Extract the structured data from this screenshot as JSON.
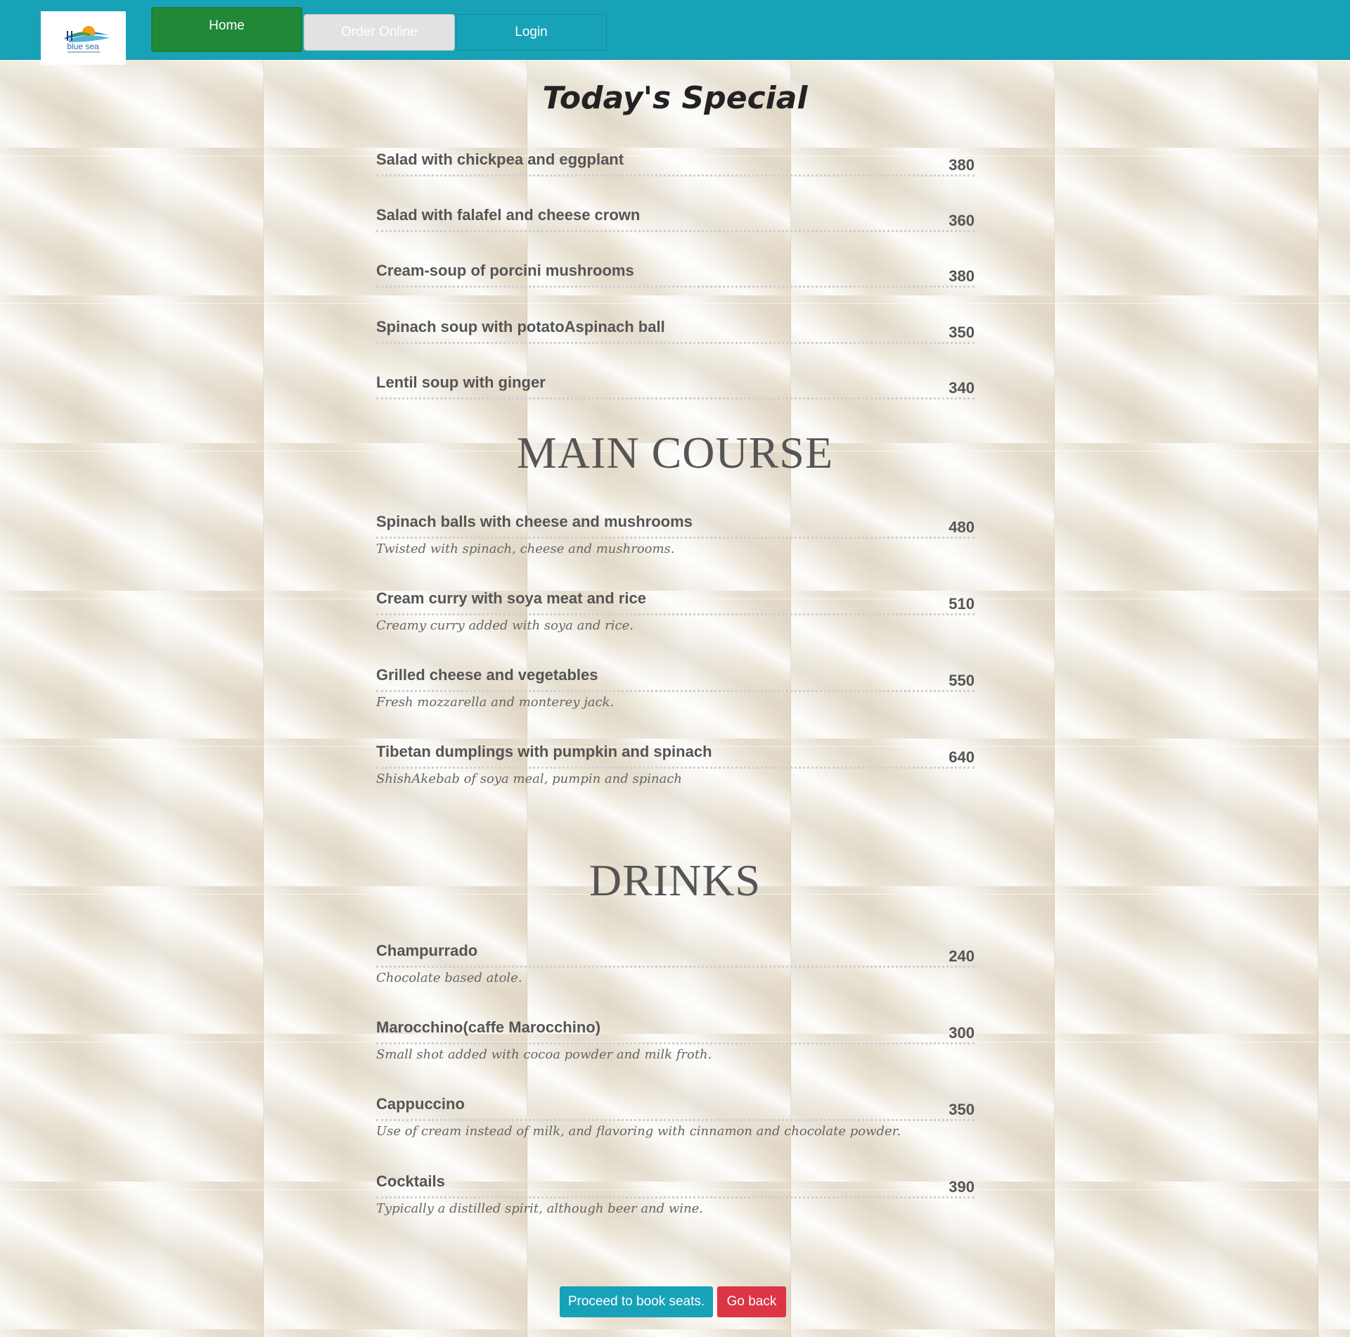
{
  "nav": {
    "logo_text": "blue sea",
    "home": "Home",
    "order_online": "Order Online",
    "login": "Login"
  },
  "sections": {
    "specials": {
      "title": "Today's Special",
      "items": [
        {
          "name": "Salad with chickpea and eggplant",
          "price": "380"
        },
        {
          "name": "Salad with falafel and cheese crown",
          "price": "360"
        },
        {
          "name": "Cream-soup of porcini mushrooms",
          "price": "380"
        },
        {
          "name": "Spinach soup with potatoAspinach ball",
          "price": "350"
        },
        {
          "name": "Lentil soup with ginger",
          "price": "340"
        }
      ]
    },
    "main_course": {
      "title": "MAIN COURSE",
      "items": [
        {
          "name": "Spinach balls with cheese and mushrooms",
          "price": "480",
          "desc": "Twisted with spinach, cheese and mushrooms."
        },
        {
          "name": "Cream curry with soya meat and rice",
          "price": "510",
          "desc": "Creamy curry added with soya and rice."
        },
        {
          "name": "Grilled cheese and vegetables",
          "price": "550",
          "desc": "Fresh mozzarella and monterey jack."
        },
        {
          "name": "Tibetan dumplings with pumpkin and spinach",
          "price": "640",
          "desc": "ShishAkebab of soya meal, pumpin and spinach"
        }
      ]
    },
    "drinks": {
      "title": "DRINKS",
      "items": [
        {
          "name": "Champurrado",
          "price": "240",
          "desc": "Chocolate based atole."
        },
        {
          "name": "Marocchino(caffe Marocchino)",
          "price": "300",
          "desc": "Small shot added with cocoa powder and milk froth."
        },
        {
          "name": "Cappuccino",
          "price": "350",
          "desc": "Use of cream instead of milk, and flavoring with cinnamon and chocolate powder."
        },
        {
          "name": "Cocktails",
          "price": "390",
          "desc": "Typically a distilled spirit, although beer and wine."
        }
      ]
    }
  },
  "actions": {
    "book": "Proceed to book seats.",
    "back": "Go back"
  },
  "colors": {
    "navbar": "#17a2b8",
    "home_button": "#218838",
    "book_button": "#17a2b8",
    "back_button": "#dc3545"
  }
}
